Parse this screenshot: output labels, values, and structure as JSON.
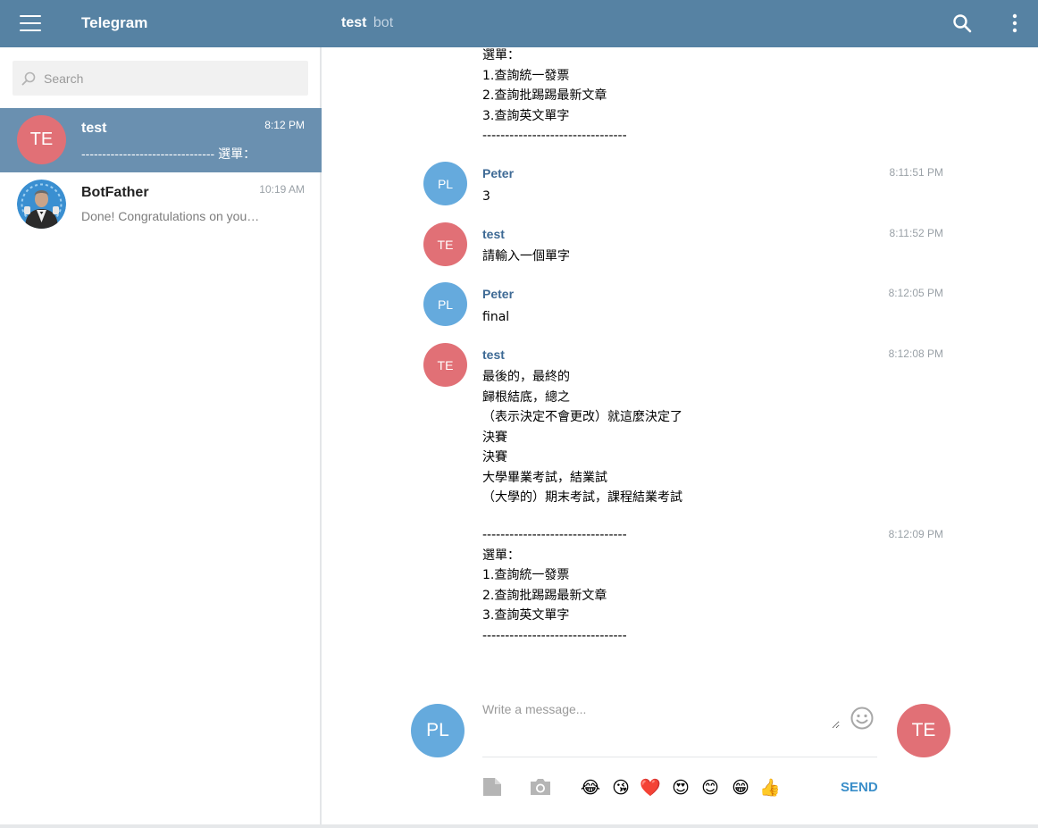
{
  "header": {
    "app_title": "Telegram",
    "chat_name": "test",
    "chat_subtitle": "bot"
  },
  "sidebar": {
    "search_placeholder": "Search",
    "dialogs": [
      {
        "initials": "TE",
        "name": "test",
        "time": "8:12 PM",
        "preview": "-------------------------------- 選單：",
        "avatar_color": "#e17076",
        "active": true
      },
      {
        "initials": "",
        "name": "BotFather",
        "time": "10:19 AM",
        "preview": "Done! Congratulations on your new bot",
        "avatar_color": "#3a8fd1",
        "active": false
      }
    ]
  },
  "messages": [
    {
      "author": "",
      "time": "",
      "lines": [
        "選單：",
        "1.查詢統一發票",
        "2.查詢批踢踢最新文章",
        "3.查詢英文單字",
        "--------------------------------"
      ]
    },
    {
      "initials": "PL",
      "author": "Peter",
      "time": "8:11:51 PM",
      "avatar_color": "#65aadd",
      "lines": [
        "3"
      ]
    },
    {
      "initials": "TE",
      "author": "test",
      "time": "8:11:52 PM",
      "avatar_color": "#e17076",
      "lines": [
        "請輸入一個單字"
      ]
    },
    {
      "initials": "PL",
      "author": "Peter",
      "time": "8:12:05 PM",
      "avatar_color": "#65aadd",
      "lines": [
        "final"
      ]
    },
    {
      "initials": "TE",
      "author": "test",
      "time": "8:12:08 PM",
      "avatar_color": "#e17076",
      "lines": [
        "最後的，最終的",
        "歸根結底，總之",
        "（表示決定不會更改）就這麼決定了",
        "決賽",
        "決賽",
        "大學畢業考試，結業試",
        "（大學的）期末考試，課程結業考試"
      ]
    },
    {
      "author": "",
      "time": "8:12:09 PM",
      "lines": [
        "--------------------------------",
        "選單：",
        "1.查詢統一發票",
        "2.查詢批踢踢最新文章",
        "3.查詢英文單字",
        "--------------------------------"
      ]
    }
  ],
  "composer": {
    "self_initials": "PL",
    "self_color": "#65aadd",
    "peer_initials": "TE",
    "peer_color": "#e17076",
    "placeholder": "Write a message...",
    "emojis": [
      "😂",
      "😘",
      "❤️",
      "😍",
      "😊",
      "😁",
      "👍"
    ],
    "send_label": "SEND"
  },
  "colors": {
    "header_bg": "#5682a3",
    "active_dialog_bg": "#6a90b0",
    "author_color": "#3e6a95",
    "send_color": "#3a8ec9"
  }
}
